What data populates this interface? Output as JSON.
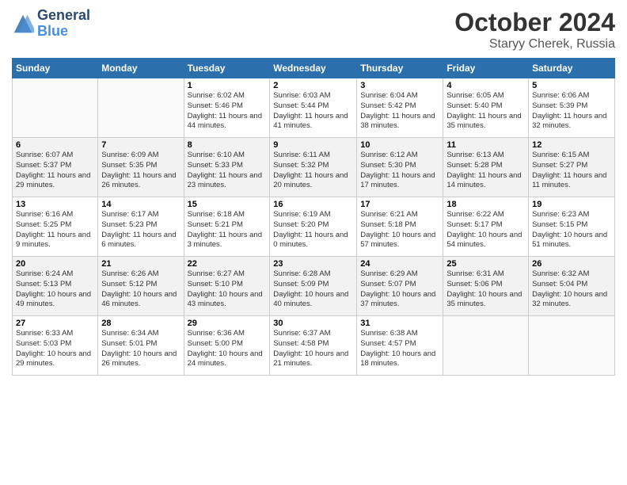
{
  "logo": {
    "line1": "General",
    "line2": "Blue"
  },
  "title": "October 2024",
  "subtitle": "Staryy Cherek, Russia",
  "headers": [
    "Sunday",
    "Monday",
    "Tuesday",
    "Wednesday",
    "Thursday",
    "Friday",
    "Saturday"
  ],
  "weeks": [
    [
      {
        "day": "",
        "info": ""
      },
      {
        "day": "",
        "info": ""
      },
      {
        "day": "1",
        "info": "Sunrise: 6:02 AM\nSunset: 5:46 PM\nDaylight: 11 hours and 44 minutes."
      },
      {
        "day": "2",
        "info": "Sunrise: 6:03 AM\nSunset: 5:44 PM\nDaylight: 11 hours and 41 minutes."
      },
      {
        "day": "3",
        "info": "Sunrise: 6:04 AM\nSunset: 5:42 PM\nDaylight: 11 hours and 38 minutes."
      },
      {
        "day": "4",
        "info": "Sunrise: 6:05 AM\nSunset: 5:40 PM\nDaylight: 11 hours and 35 minutes."
      },
      {
        "day": "5",
        "info": "Sunrise: 6:06 AM\nSunset: 5:39 PM\nDaylight: 11 hours and 32 minutes."
      }
    ],
    [
      {
        "day": "6",
        "info": "Sunrise: 6:07 AM\nSunset: 5:37 PM\nDaylight: 11 hours and 29 minutes."
      },
      {
        "day": "7",
        "info": "Sunrise: 6:09 AM\nSunset: 5:35 PM\nDaylight: 11 hours and 26 minutes."
      },
      {
        "day": "8",
        "info": "Sunrise: 6:10 AM\nSunset: 5:33 PM\nDaylight: 11 hours and 23 minutes."
      },
      {
        "day": "9",
        "info": "Sunrise: 6:11 AM\nSunset: 5:32 PM\nDaylight: 11 hours and 20 minutes."
      },
      {
        "day": "10",
        "info": "Sunrise: 6:12 AM\nSunset: 5:30 PM\nDaylight: 11 hours and 17 minutes."
      },
      {
        "day": "11",
        "info": "Sunrise: 6:13 AM\nSunset: 5:28 PM\nDaylight: 11 hours and 14 minutes."
      },
      {
        "day": "12",
        "info": "Sunrise: 6:15 AM\nSunset: 5:27 PM\nDaylight: 11 hours and 11 minutes."
      }
    ],
    [
      {
        "day": "13",
        "info": "Sunrise: 6:16 AM\nSunset: 5:25 PM\nDaylight: 11 hours and 9 minutes."
      },
      {
        "day": "14",
        "info": "Sunrise: 6:17 AM\nSunset: 5:23 PM\nDaylight: 11 hours and 6 minutes."
      },
      {
        "day": "15",
        "info": "Sunrise: 6:18 AM\nSunset: 5:21 PM\nDaylight: 11 hours and 3 minutes."
      },
      {
        "day": "16",
        "info": "Sunrise: 6:19 AM\nSunset: 5:20 PM\nDaylight: 11 hours and 0 minutes."
      },
      {
        "day": "17",
        "info": "Sunrise: 6:21 AM\nSunset: 5:18 PM\nDaylight: 10 hours and 57 minutes."
      },
      {
        "day": "18",
        "info": "Sunrise: 6:22 AM\nSunset: 5:17 PM\nDaylight: 10 hours and 54 minutes."
      },
      {
        "day": "19",
        "info": "Sunrise: 6:23 AM\nSunset: 5:15 PM\nDaylight: 10 hours and 51 minutes."
      }
    ],
    [
      {
        "day": "20",
        "info": "Sunrise: 6:24 AM\nSunset: 5:13 PM\nDaylight: 10 hours and 49 minutes."
      },
      {
        "day": "21",
        "info": "Sunrise: 6:26 AM\nSunset: 5:12 PM\nDaylight: 10 hours and 46 minutes."
      },
      {
        "day": "22",
        "info": "Sunrise: 6:27 AM\nSunset: 5:10 PM\nDaylight: 10 hours and 43 minutes."
      },
      {
        "day": "23",
        "info": "Sunrise: 6:28 AM\nSunset: 5:09 PM\nDaylight: 10 hours and 40 minutes."
      },
      {
        "day": "24",
        "info": "Sunrise: 6:29 AM\nSunset: 5:07 PM\nDaylight: 10 hours and 37 minutes."
      },
      {
        "day": "25",
        "info": "Sunrise: 6:31 AM\nSunset: 5:06 PM\nDaylight: 10 hours and 35 minutes."
      },
      {
        "day": "26",
        "info": "Sunrise: 6:32 AM\nSunset: 5:04 PM\nDaylight: 10 hours and 32 minutes."
      }
    ],
    [
      {
        "day": "27",
        "info": "Sunrise: 6:33 AM\nSunset: 5:03 PM\nDaylight: 10 hours and 29 minutes."
      },
      {
        "day": "28",
        "info": "Sunrise: 6:34 AM\nSunset: 5:01 PM\nDaylight: 10 hours and 26 minutes."
      },
      {
        "day": "29",
        "info": "Sunrise: 6:36 AM\nSunset: 5:00 PM\nDaylight: 10 hours and 24 minutes."
      },
      {
        "day": "30",
        "info": "Sunrise: 6:37 AM\nSunset: 4:58 PM\nDaylight: 10 hours and 21 minutes."
      },
      {
        "day": "31",
        "info": "Sunrise: 6:38 AM\nSunset: 4:57 PM\nDaylight: 10 hours and 18 minutes."
      },
      {
        "day": "",
        "info": ""
      },
      {
        "day": "",
        "info": ""
      }
    ]
  ]
}
